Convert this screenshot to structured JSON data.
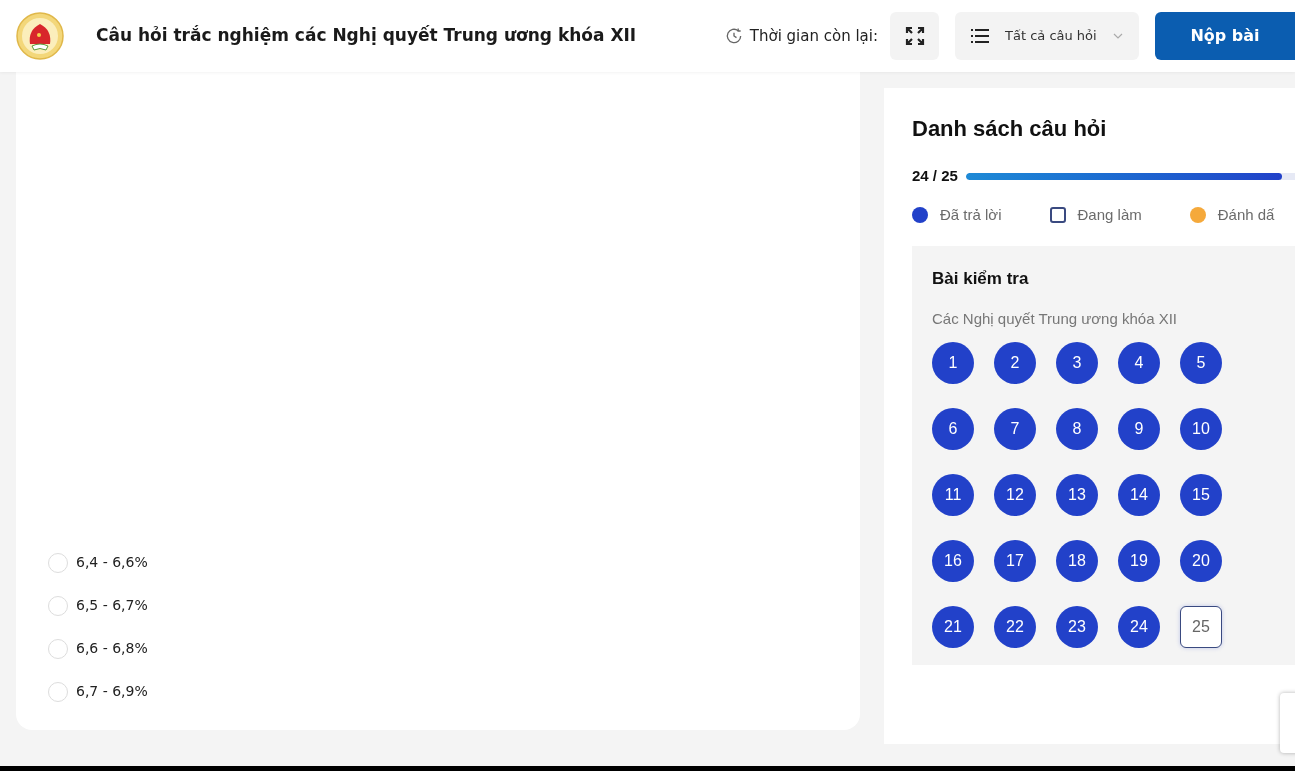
{
  "header": {
    "title": "Câu hỏi trắc nghiệm các Nghị quyết Trung ương khóa XII",
    "timer_label": "Thời gian còn lại:",
    "filter": {
      "value": "Tất cả câu hỏi"
    },
    "submit": "Nộp bài"
  },
  "question": {
    "options": [
      {
        "label": "6,4 - 6,6%",
        "selected": false
      },
      {
        "label": "6,5 - 6,7%",
        "selected": false
      },
      {
        "label": "6,6 - 6,8%",
        "selected": false
      },
      {
        "label": "6,7 - 6,9%",
        "selected": false
      }
    ]
  },
  "sidebar": {
    "title": "Danh sách câu hỏi",
    "progress": {
      "reading": "24 / 25",
      "level": 0.96
    },
    "legend": [
      {
        "kind": "dot",
        "label": "Đã trả lời",
        "color": "#2241c9"
      },
      {
        "kind": "box",
        "label": "Đang làm"
      },
      {
        "kind": "dot",
        "label": "Đánh dấ",
        "color": "#f5a93b"
      }
    ],
    "section": {
      "title": "Bài kiểm tra",
      "subtitle": "Các Nghị quyết Trung ương khóa XII",
      "questions": [
        {
          "number": "1",
          "kind": "answered"
        },
        {
          "number": "2",
          "kind": "answered"
        },
        {
          "number": "3",
          "kind": "answered"
        },
        {
          "number": "4",
          "kind": "answered"
        },
        {
          "number": "5",
          "kind": "answered"
        },
        {
          "number": "6",
          "kind": "answered"
        },
        {
          "number": "7",
          "kind": "answered"
        },
        {
          "number": "8",
          "kind": "answered"
        },
        {
          "number": "9",
          "kind": "answered"
        },
        {
          "number": "10",
          "kind": "answered"
        },
        {
          "number": "11",
          "kind": "answered"
        },
        {
          "number": "12",
          "kind": "answered"
        },
        {
          "number": "13",
          "kind": "answered"
        },
        {
          "number": "14",
          "kind": "answered"
        },
        {
          "number": "15",
          "kind": "answered"
        },
        {
          "number": "16",
          "kind": "answered"
        },
        {
          "number": "17",
          "kind": "answered"
        },
        {
          "number": "18",
          "kind": "answered"
        },
        {
          "number": "19",
          "kind": "answered"
        },
        {
          "number": "20",
          "kind": "answered"
        },
        {
          "number": "21",
          "kind": "answered"
        },
        {
          "number": "22",
          "kind": "answered"
        },
        {
          "number": "23",
          "kind": "answered"
        },
        {
          "number": "24",
          "kind": "answered"
        },
        {
          "number": "25",
          "kind": "current"
        }
      ]
    }
  }
}
